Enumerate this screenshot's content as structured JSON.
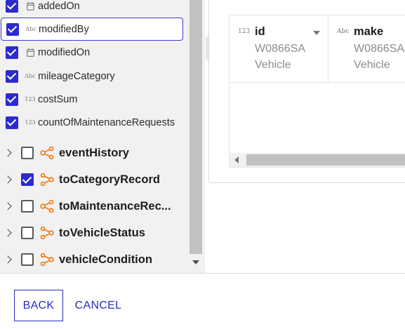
{
  "fields": [
    {
      "name": "addedOn",
      "type": "date",
      "checked": true,
      "selected": false
    },
    {
      "name": "modifiedBy",
      "type": "text",
      "type_label": "Abc",
      "checked": true,
      "selected": true
    },
    {
      "name": "modifiedOn",
      "type": "date",
      "checked": true,
      "selected": false
    },
    {
      "name": "mileageCategory",
      "type": "text",
      "type_label": "Abc",
      "checked": true,
      "selected": false
    },
    {
      "name": "costSum",
      "type": "number",
      "type_label": "123",
      "checked": true,
      "selected": false
    },
    {
      "name": "countOfMaintenanceRequests",
      "type": "number",
      "type_label": "123",
      "checked": true,
      "selected": false
    }
  ],
  "relationships": [
    {
      "name": "eventHistory",
      "icon": "one-to-many-relation-icon",
      "checked": false
    },
    {
      "name": "toCategoryRecord",
      "icon": "many-to-one-relation-icon",
      "checked": true
    },
    {
      "name": "toMaintenanceRec...",
      "icon": "one-to-many-relation-icon",
      "checked": false
    },
    {
      "name": "toVehicleStatus",
      "icon": "many-to-one-relation-icon",
      "checked": false
    },
    {
      "name": "vehicleCondition",
      "icon": "many-to-one-relation-icon",
      "checked": false
    }
  ],
  "preview": {
    "columns": [
      {
        "name": "id",
        "type_label": "123",
        "sample_1": "W0866SA",
        "sample_2": "Vehicle"
      },
      {
        "name": "make",
        "type_label": "Abc",
        "sample_1": "W0866SA",
        "sample_2": "Vehicle"
      }
    ]
  },
  "footer": {
    "back_label": "BACK",
    "cancel_label": "CANCEL"
  },
  "colors": {
    "accent": "#2b2bd0",
    "relation_icon": "#f07d1c",
    "button_text": "#2b2bbf"
  }
}
